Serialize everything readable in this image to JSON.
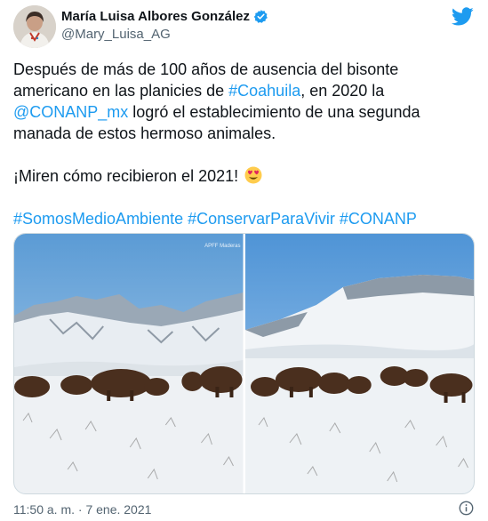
{
  "author": {
    "display_name": "María Luisa Albores González",
    "handle": "@Mary_Luisa_AG",
    "avatar_icon": "profile-photo",
    "verified_icon": "verified-badge-icon"
  },
  "platform_icon": "twitter-bird-icon",
  "tweet": {
    "line1_text": "Después de más de 100 años de ausencia del bisonte americano en las planicies de ",
    "hashtag_coahuila": "#Coahuila",
    "line1_after": ", en 2020 la ",
    "mention": "@CONANP_mx",
    "line2_text": " logró el establecimiento de una segunda manada de estos hermoso animales.",
    "line3_text": "¡Miren cómo recibieron el 2021! ",
    "emoji_icon": "heart-eyes-emoji-icon",
    "hashtag_1": "#SomosMedioAmbiente",
    "hashtag_2": "#ConservarParaVivir",
    "hashtag_3": "#CONANP"
  },
  "media": {
    "photo_1_watermark": "APFF Maderas"
  },
  "footer": {
    "timestamp": "11:50 a. m. · 7 ene. 2021",
    "info_icon": "info-icon"
  },
  "colors": {
    "link": "#1d9bf0",
    "text": "#0f1419",
    "secondary": "#536471"
  }
}
